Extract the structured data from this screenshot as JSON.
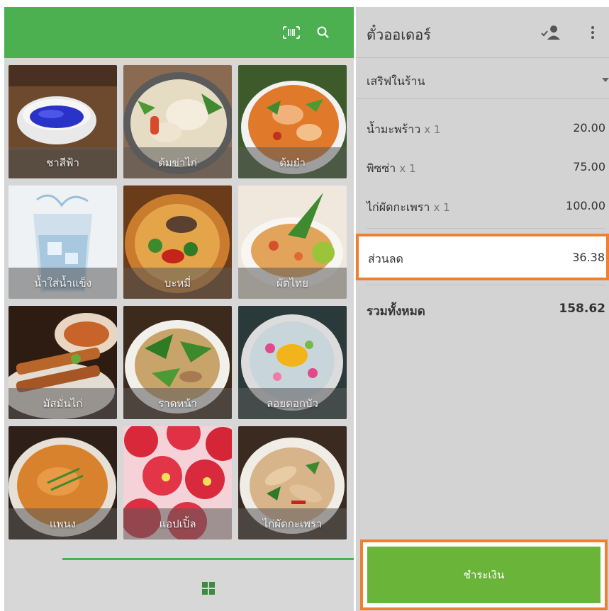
{
  "left_panel": {
    "top_bar": {
      "icons": [
        "barcode-icon",
        "search-icon"
      ]
    },
    "menu_items": [
      {
        "label": "ชาสีฟ้า"
      },
      {
        "label": "ต้มข่าไก่"
      },
      {
        "label": "ต้มยำ"
      },
      {
        "label": "น้ำใส่น้ำแข็ง"
      },
      {
        "label": "บะหมี่"
      },
      {
        "label": "ผัดไทย"
      },
      {
        "label": "มัสมั่นไก่"
      },
      {
        "label": "ราดหน้า"
      },
      {
        "label": "ลอยดอกบัว"
      },
      {
        "label": "แพนง"
      },
      {
        "label": "แอปเปิ้ล"
      },
      {
        "label": "ไก่ผัดกะเพรา"
      }
    ],
    "bottom_nav": {
      "icon": "grid-icon"
    }
  },
  "order_panel": {
    "title": "ตั๋วออเดอร์",
    "header_icons": [
      "person-check-icon",
      "more-vert-icon"
    ],
    "service_type": "เสริฟในร้าน",
    "items": [
      {
        "name": "น้ำมะพร้าว",
        "qty": "x 1",
        "price": "20.00"
      },
      {
        "name": "พิซซ่า",
        "qty": "x 1",
        "price": "75.00"
      },
      {
        "name": "ไก่ผัดกะเพรา",
        "qty": "x 1",
        "price": "100.00"
      }
    ],
    "discount": {
      "label": "ส่วนลด",
      "value": "36.38"
    },
    "total": {
      "label": "รวมทั้งหมด",
      "value": "158.62"
    },
    "pay_button": "ชำระเงิน"
  },
  "colors": {
    "header_green": "#4caf50",
    "pay_green": "#6ab43a",
    "highlight_orange": "#f08030",
    "panel_gray": "#d3d3d3"
  }
}
